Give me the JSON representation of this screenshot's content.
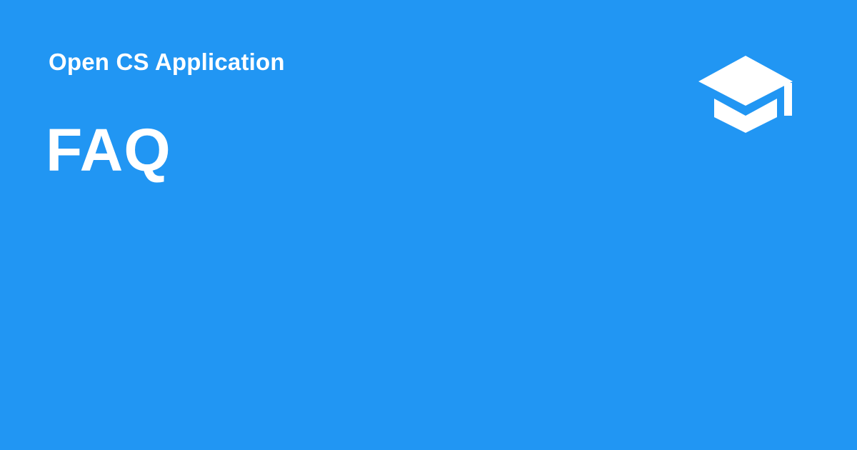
{
  "site": {
    "name": "Open CS Application"
  },
  "page": {
    "title": "FAQ"
  },
  "logo": {
    "icon": "graduation-cap-icon"
  },
  "colors": {
    "background": "#2196f3",
    "foreground": "#ffffff"
  }
}
